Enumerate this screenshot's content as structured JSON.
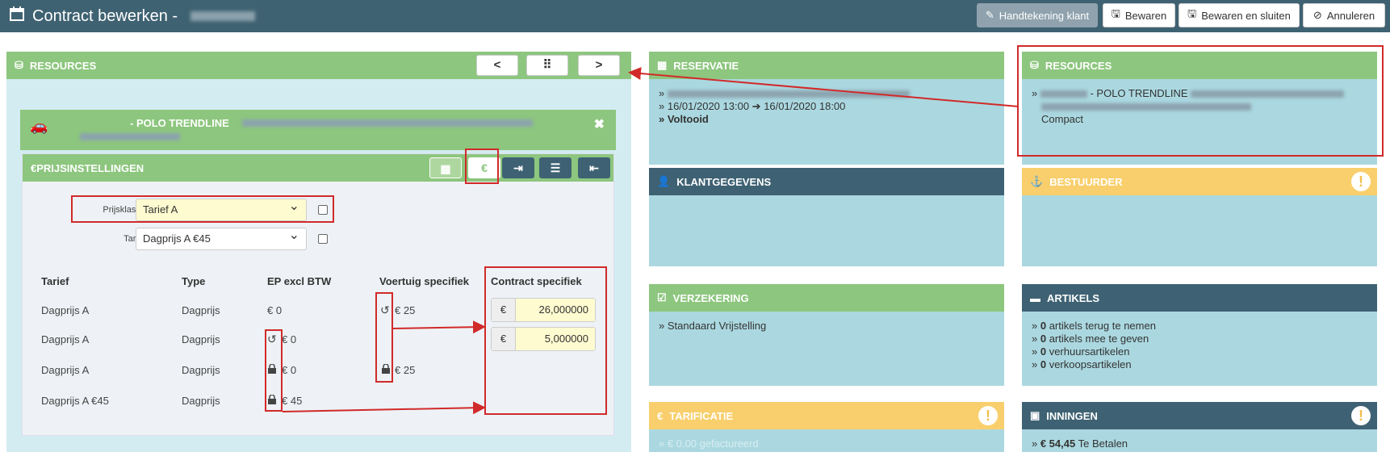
{
  "header": {
    "title": "Contract bewerken -",
    "buttons": {
      "signature": "Handtekening klant",
      "save": "Bewaren",
      "save_close": "Bewaren en sluiten",
      "cancel": "Annuleren"
    }
  },
  "resources_left": {
    "title": "RESOURCES",
    "nav": {
      "prev": "<",
      "grid": "⠿",
      "next": ">"
    },
    "vehicle": {
      "name": "- POLO TRENDLINE"
    },
    "prijs": {
      "title": "PRIJSINSTELLINGEN",
      "prijsklasse_label": "Prijsklasse",
      "prijsklasse_value": "Tarief A",
      "tarief_label": "Tarief",
      "tarief_value": "Dagprijs A €45",
      "columns": [
        "Tarief",
        "Type",
        "EP excl BTW",
        "Voertuig specifiek",
        "Contract specifiek"
      ],
      "rows": [
        {
          "tarief": "Dagprijs A",
          "type": "Dagprijs",
          "ep": "€ 0",
          "voertuig": "€ 25",
          "contract": "26,000000"
        },
        {
          "tarief": "Dagprijs A",
          "type": "Dagprijs",
          "ep": "€ 0",
          "voertuig": "",
          "contract": "5,000000"
        },
        {
          "tarief": "Dagprijs A",
          "type": "Dagprijs",
          "ep": "€ 0",
          "voertuig": "€ 25",
          "contract": ""
        },
        {
          "tarief": "Dagprijs A €45",
          "type": "Dagprijs",
          "ep": "€ 45",
          "voertuig": "",
          "contract": ""
        }
      ],
      "currency": "€"
    }
  },
  "reservatie": {
    "title": "RESERVATIE",
    "from": "16/01/2020 13:00",
    "to": "16/01/2020 18:00",
    "status": "Voltooid"
  },
  "resources_right": {
    "title": "RESOURCES",
    "vehicle": "- POLO TRENDLINE",
    "category": "Compact"
  },
  "klantgegevens": {
    "title": "KLANTGEGEVENS"
  },
  "bestuurder": {
    "title": "BESTUURDER"
  },
  "verzekering": {
    "title": "VERZEKERING",
    "item": "Standaard Vrijstelling"
  },
  "artikels": {
    "title": "ARTIKELS",
    "items": [
      {
        "count": "0",
        "text": "artikels terug te nemen"
      },
      {
        "count": "0",
        "text": "artikels mee te geven"
      },
      {
        "count": "0",
        "text": "verhuursartikelen"
      },
      {
        "count": "0",
        "text": "verkoopsartikelen"
      }
    ]
  },
  "tarificatie": {
    "title": "TARIFICATIE",
    "item": "€ 0,00 gefactureerd"
  },
  "inningen": {
    "title": "INNINGEN",
    "amount": "€ 54,45",
    "text": "Te Betalen"
  },
  "colors": {
    "navy": "#3e6273",
    "green": "#8dc67e",
    "yellow": "#f8cf6c",
    "light_blue": "#abd8e0",
    "annotation_red": "#d12a2a"
  }
}
